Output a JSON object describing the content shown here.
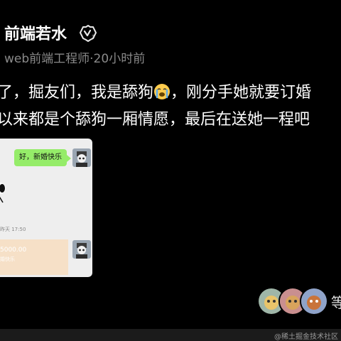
{
  "author": {
    "name": "前端若水",
    "badge_level": "3",
    "meta": "web前端工程师·20小时前"
  },
  "post": {
    "line1_a": "了，掘友们，我是舔狗",
    "line1_b": "，刚分手她就要订婚",
    "line2": "以来都是个舔狗一厢情愿，最后在送她一程吧",
    "emoji": "crying-face-icon"
  },
  "screenshot": {
    "bubble_text": "好，新婚快乐",
    "timestamp": "昨天 17:50",
    "transfer_amount": "5000.00",
    "transfer_note": "婚快乐"
  },
  "reactions": {
    "more_label": "等"
  },
  "watermark": "@稀土掘金技术社区",
  "colors": {
    "bubble": "#95ec69",
    "transfer": "#f6e0c7",
    "meta": "#8a8a8a"
  }
}
